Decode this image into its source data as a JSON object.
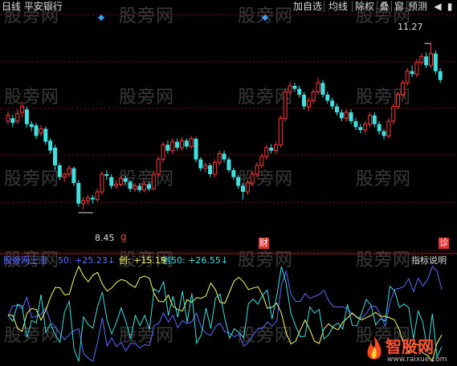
{
  "chart_title": "日线 平安银行",
  "toolbar": [
    {
      "label": "加自选",
      "name": "add-watchlist-button"
    },
    {
      "label": "均线",
      "name": "moving-average-button"
    },
    {
      "label": "除权",
      "name": "ex-rights-button"
    },
    {
      "label": "叠",
      "name": "overlay-button"
    },
    {
      "label": "窗",
      "name": "window-button"
    },
    {
      "label": "预测",
      "name": "forecast-button"
    }
  ],
  "watermarks": [
    "股旁网",
    "股旁网",
    "股旁网",
    "股旁网",
    "股旁网",
    "股旁网",
    "股旁网",
    "股旁网",
    "股旁网",
    "股旁网",
    "股旁网",
    "股旁网",
    "股旁网",
    "股旁网",
    "股旁网",
    "股旁网",
    "股旁网",
    "股旁网",
    "股旁网",
    "股旁网"
  ],
  "price_labels": {
    "high": "11.27",
    "low": "8.45"
  },
  "markers": {
    "finance": "财",
    "diagnose": "诊",
    "g": "g"
  },
  "indicator": {
    "name": "股旁网上涨",
    "v1_label": "50: +25.23↓",
    "v2_label": "创: +15.19",
    "v3_label": "创50: +26.55↓",
    "help": "指标说明"
  },
  "logo_text": "智股网",
  "logo_sub": "www.raixue.com",
  "colors": {
    "up": "#ff3a3a",
    "down": "#3fe0e0",
    "blue": "#5a6cff",
    "yellow": "#ffff66",
    "cyan": "#3fe0e0",
    "grid": "#7a1010"
  },
  "chart_data": {
    "type": "candlestick",
    "ylim": [
      8.0,
      11.6
    ],
    "candles": [
      [
        9.95,
        10.05,
        10.12,
        9.9
      ],
      [
        10.0,
        9.92,
        10.06,
        9.85
      ],
      [
        9.95,
        10.08,
        10.15,
        9.9
      ],
      [
        10.1,
        10.2,
        10.28,
        10.02
      ],
      [
        10.15,
        9.9,
        10.2,
        9.84
      ],
      [
        9.9,
        9.85,
        9.95,
        9.78
      ],
      [
        9.88,
        9.7,
        9.92,
        9.65
      ],
      [
        9.75,
        9.82,
        9.88,
        9.7
      ],
      [
        9.82,
        9.6,
        9.86,
        9.55
      ],
      [
        9.62,
        9.45,
        9.66,
        9.4
      ],
      [
        9.5,
        9.2,
        9.55,
        9.12
      ],
      [
        9.2,
        9.0,
        9.24,
        8.95
      ],
      [
        9.0,
        9.05,
        9.08,
        8.92
      ],
      [
        9.05,
        9.15,
        9.2,
        9.0
      ],
      [
        9.15,
        8.9,
        9.18,
        8.85
      ],
      [
        8.9,
        8.55,
        8.95,
        8.5
      ],
      [
        8.55,
        8.6,
        8.66,
        8.45
      ],
      [
        8.6,
        8.65,
        8.7,
        8.52
      ],
      [
        8.65,
        8.62,
        8.7,
        8.55
      ],
      [
        8.62,
        8.75,
        8.8,
        8.58
      ],
      [
        8.75,
        9.05,
        9.1,
        8.7
      ],
      [
        9.05,
        9.02,
        9.12,
        8.95
      ],
      [
        9.0,
        8.85,
        9.05,
        8.8
      ],
      [
        8.85,
        8.88,
        8.95,
        8.8
      ],
      [
        8.88,
        8.98,
        9.02,
        8.84
      ],
      [
        8.98,
        8.92,
        9.02,
        8.88
      ],
      [
        8.92,
        8.8,
        8.95,
        8.75
      ],
      [
        8.8,
        8.85,
        8.9,
        8.75
      ],
      [
        8.85,
        8.78,
        8.9,
        8.74
      ],
      [
        8.78,
        8.88,
        8.92,
        8.74
      ],
      [
        8.88,
        8.8,
        8.92,
        8.76
      ],
      [
        8.8,
        9.05,
        9.1,
        8.78
      ],
      [
        9.05,
        9.3,
        9.35,
        9.0
      ],
      [
        9.3,
        9.55,
        9.6,
        9.25
      ],
      [
        9.55,
        9.45,
        9.62,
        9.4
      ],
      [
        9.45,
        9.6,
        9.66,
        9.4
      ],
      [
        9.6,
        9.5,
        9.65,
        9.46
      ],
      [
        9.5,
        9.62,
        9.68,
        9.45
      ],
      [
        9.62,
        9.52,
        9.66,
        9.48
      ],
      [
        9.52,
        9.65,
        9.7,
        9.48
      ],
      [
        9.65,
        9.3,
        9.68,
        9.25
      ],
      [
        9.3,
        9.15,
        9.34,
        9.1
      ],
      [
        9.15,
        9.2,
        9.25,
        9.08
      ],
      [
        9.2,
        9.05,
        9.24,
        9.0
      ],
      [
        9.05,
        9.25,
        9.3,
        9.0
      ],
      [
        9.25,
        9.4,
        9.45,
        9.2
      ],
      [
        9.4,
        9.3,
        9.45,
        9.25
      ],
      [
        9.3,
        9.12,
        9.34,
        9.08
      ],
      [
        9.12,
        9.0,
        9.16,
        8.95
      ],
      [
        9.0,
        8.85,
        9.04,
        8.8
      ],
      [
        8.85,
        8.75,
        8.9,
        8.62
      ],
      [
        8.75,
        8.9,
        8.95,
        8.7
      ],
      [
        8.9,
        9.05,
        9.1,
        8.85
      ],
      [
        9.05,
        9.2,
        9.25,
        9.0
      ],
      [
        9.2,
        9.35,
        9.4,
        9.15
      ],
      [
        9.35,
        9.5,
        9.55,
        9.3
      ],
      [
        9.5,
        9.45,
        9.56,
        9.4
      ],
      [
        9.45,
        9.55,
        9.6,
        9.4
      ],
      [
        9.55,
        10.0,
        10.05,
        9.5
      ],
      [
        10.0,
        10.45,
        10.5,
        9.95
      ],
      [
        10.45,
        10.55,
        10.62,
        10.4
      ],
      [
        10.55,
        10.5,
        10.6,
        10.45
      ],
      [
        10.5,
        10.4,
        10.55,
        10.35
      ],
      [
        10.4,
        10.2,
        10.45,
        10.15
      ],
      [
        10.2,
        10.3,
        10.35,
        10.12
      ],
      [
        10.3,
        10.45,
        10.5,
        10.25
      ],
      [
        10.45,
        10.6,
        10.68,
        10.4
      ],
      [
        10.6,
        10.4,
        10.65,
        10.35
      ],
      [
        10.4,
        10.3,
        10.45,
        10.25
      ],
      [
        10.3,
        10.2,
        10.35,
        10.15
      ],
      [
        10.2,
        10.1,
        10.25,
        10.05
      ],
      [
        10.1,
        10.0,
        10.15,
        9.95
      ],
      [
        10.0,
        10.1,
        10.15,
        9.95
      ],
      [
        10.1,
        9.95,
        10.15,
        9.9
      ],
      [
        9.95,
        9.85,
        10.0,
        9.8
      ],
      [
        9.85,
        9.8,
        9.9,
        9.74
      ],
      [
        9.8,
        9.9,
        9.95,
        9.75
      ],
      [
        9.9,
        10.05,
        10.1,
        9.85
      ],
      [
        10.05,
        9.9,
        10.1,
        9.85
      ],
      [
        9.9,
        9.78,
        9.95,
        9.72
      ],
      [
        9.78,
        9.7,
        9.82,
        9.64
      ],
      [
        9.7,
        9.95,
        10.0,
        9.66
      ],
      [
        9.95,
        10.2,
        10.25,
        9.9
      ],
      [
        10.2,
        10.4,
        10.45,
        10.15
      ],
      [
        10.4,
        10.6,
        10.65,
        10.35
      ],
      [
        10.6,
        10.8,
        10.85,
        10.55
      ],
      [
        10.8,
        10.75,
        10.9,
        10.7
      ],
      [
        10.75,
        10.95,
        11.0,
        10.7
      ],
      [
        10.95,
        11.05,
        11.1,
        10.9
      ],
      [
        11.05,
        10.9,
        11.12,
        10.85
      ],
      [
        10.9,
        11.1,
        11.27,
        10.85
      ],
      [
        11.1,
        10.8,
        11.15,
        10.75
      ],
      [
        10.8,
        10.65,
        10.85,
        10.6
      ]
    ]
  }
}
